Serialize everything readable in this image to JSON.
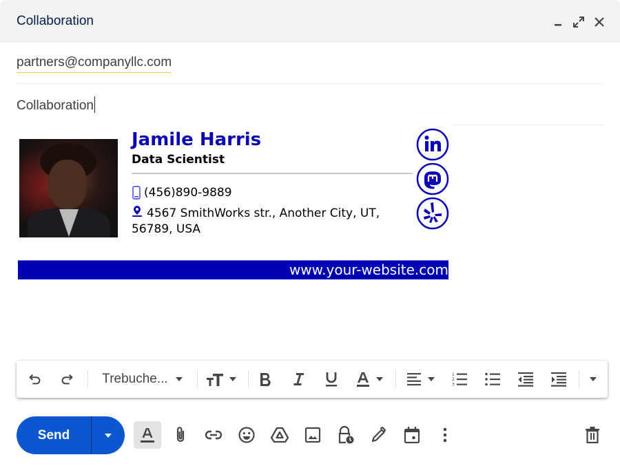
{
  "window": {
    "title": "Collaboration",
    "controls": [
      "minimize-icon",
      "expand-icon",
      "close-icon"
    ]
  },
  "compose": {
    "to": "partners@companyllc.com",
    "subject": "Collaboration"
  },
  "signature": {
    "name": "Jamile Harris",
    "role": "Data Scientist",
    "phone": "(456)890-9889",
    "address": "4567 SmithWorks str., Another City, UT, 56789, USA",
    "website": "www.your-website.com",
    "socials": [
      "linkedin",
      "mastodon",
      "yelp"
    ],
    "accent_color": "#0a06b5"
  },
  "format_toolbar": {
    "font": "Trebuche...",
    "items": [
      "undo",
      "redo",
      "font",
      "text-size",
      "bold",
      "italic",
      "underline",
      "text-color",
      "align",
      "numbered-list",
      "bulleted-list",
      "indent-less",
      "indent-more",
      "more-formatting"
    ]
  },
  "bottom_toolbar": {
    "send_label": "Send",
    "send_color": "#0b57d0",
    "items": [
      "formatting-options",
      "attach-files",
      "insert-link",
      "insert-emoji",
      "insert-drive",
      "insert-photo",
      "confidential-mode",
      "insert-signature",
      "set-up-time",
      "more-options",
      "discard-draft"
    ]
  }
}
